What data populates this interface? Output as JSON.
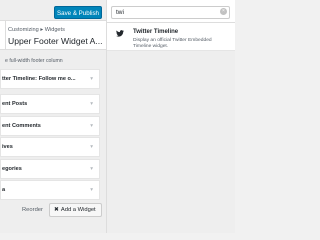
{
  "header": {
    "save_label": "Save & Publish"
  },
  "section": {
    "breadcrumb": "Customizing ▸ Widgets",
    "title": "Upper Footer Widget A...",
    "description": "e full-width footer column"
  },
  "widgets": [
    {
      "label": "tter Timeline: Follow me o..."
    },
    {
      "label": "ent Posts"
    },
    {
      "label": "ent Comments"
    },
    {
      "label": "ives"
    },
    {
      "label": "egories"
    },
    {
      "label": "a"
    }
  ],
  "widget_arrow": "▾",
  "footer": {
    "reorder_label": "Reorder",
    "add_widget_label": "Add a Widget",
    "add_widget_icon": "✖"
  },
  "search": {
    "value": "twi",
    "clear_icon": "×"
  },
  "result": {
    "title": "Twitter Timeline",
    "description": "Display an official Twitter Embedded Timeline widget."
  },
  "colors": {
    "primary": "#0085ba",
    "twitter_icon": "#23282d"
  }
}
